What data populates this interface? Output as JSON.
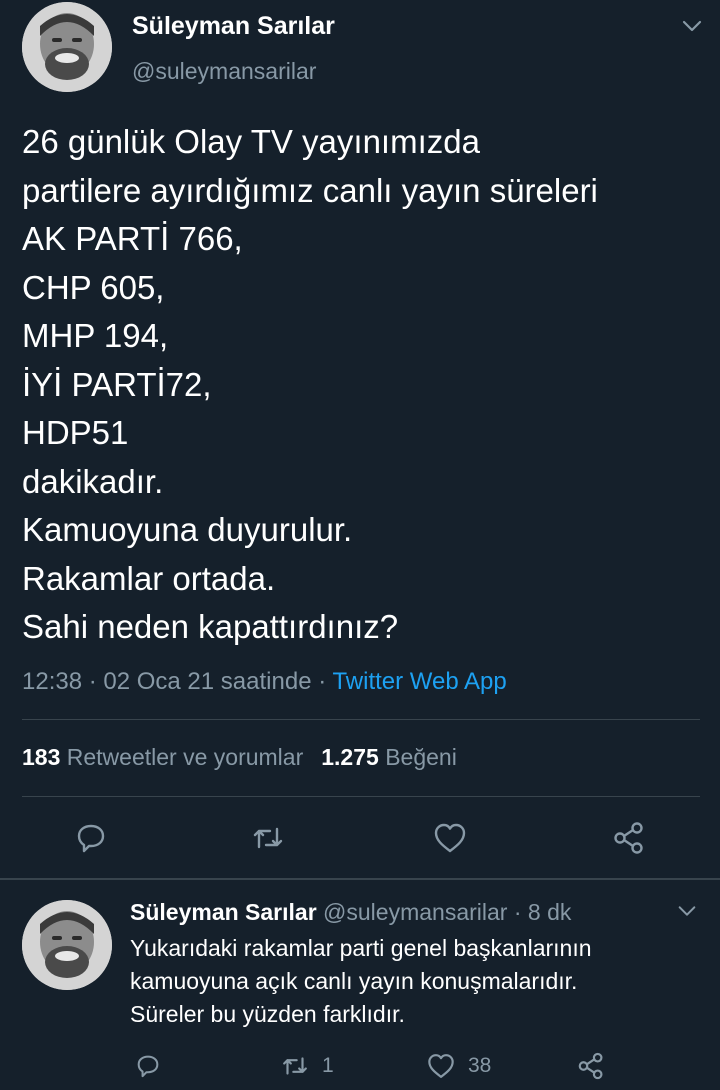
{
  "colors": {
    "background": "#15202b",
    "text": "#ffffff",
    "secondary": "#8899a6",
    "link": "#1da1f2",
    "divider": "#38444d"
  },
  "main_tweet": {
    "author_name": "Süleyman Sarılar",
    "author_handle": "@suleymansarilar",
    "lines": [
      "26 günlük Olay TV yayınımızda",
      "partilere ayırdığımız canlı yayın süreleri",
      "AK PARTİ 766,",
      "CHP 605,",
      "MHP 194,",
      "İYİ PARTİ72,",
      "HDP51",
      "dakikadır.",
      "Kamuoyuna duyurulur.",
      "Rakamlar ortada.",
      "Sahi neden kapattırdınız?"
    ],
    "timestamp": "12:38 · 02 Oca 21 saatinde ·",
    "source": "Twitter Web App",
    "retweets_count": "183",
    "retweets_label": "Retweetler ve yorumlar",
    "likes_count": "1.275",
    "likes_label": "Beğeni",
    "icons": [
      "reply-icon",
      "retweet-icon",
      "like-icon",
      "share-icon"
    ]
  },
  "reply_tweet": {
    "author_name": "Süleyman Sarılar",
    "author_handle": "@suleymansarilar · 8 dk",
    "lines": [
      "Yukarıdaki rakamlar parti genel başkanlarının",
      "kamuoyuna açık canlı yayın konuşmalarıdır.",
      "Süreler bu yüzden farklıdır."
    ],
    "retweet_count": "1",
    "like_count": "38"
  }
}
